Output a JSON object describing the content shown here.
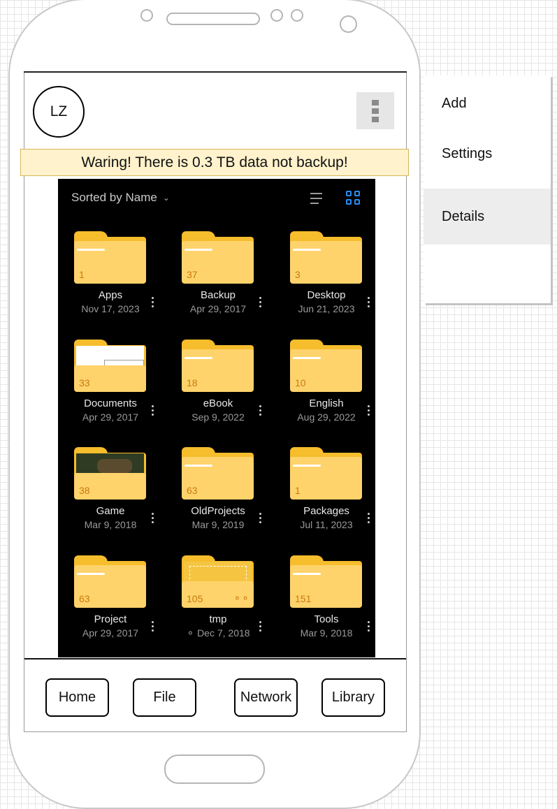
{
  "profile": {
    "initials": "LZ"
  },
  "banner": {
    "text": "Waring! There is 0.3 TB data not backup!"
  },
  "browser": {
    "sort_label": "Sorted by Name",
    "folders": [
      {
        "name": "Apps",
        "count": "1",
        "date": "Nov 17, 2023"
      },
      {
        "name": "Backup",
        "count": "37",
        "date": "Apr 29, 2017"
      },
      {
        "name": "Desktop",
        "count": "3",
        "date": "Jun 21, 2023"
      },
      {
        "name": "Documents",
        "count": "33",
        "date": "Apr 29, 2017"
      },
      {
        "name": "eBook",
        "count": "18",
        "date": "Sep 9, 2022"
      },
      {
        "name": "English",
        "count": "10",
        "date": "Aug 29, 2022"
      },
      {
        "name": "Game",
        "count": "38",
        "date": "Mar 9, 2018"
      },
      {
        "name": "OldProjects",
        "count": "63",
        "date": "Mar 9, 2019"
      },
      {
        "name": "Packages",
        "count": "1",
        "date": "Jul 11, 2023"
      },
      {
        "name": "Project",
        "count": "63",
        "date": "Apr 29, 2017"
      },
      {
        "name": "tmp",
        "count": "105",
        "date": "Dec 7, 2018",
        "shared": true
      },
      {
        "name": "Tools",
        "count": "151",
        "date": "Mar 9, 2018"
      }
    ]
  },
  "nav": {
    "items": [
      "Home",
      "File",
      "Network",
      "Library"
    ]
  },
  "menu": {
    "items": [
      "Add",
      "Settings",
      "Details"
    ],
    "highlighted": "Details"
  },
  "colors": {
    "folder": "#ffd36b",
    "folder_back": "#f6bd2c",
    "accent": "#2b8cf0",
    "banner_bg": "#fff2cc"
  }
}
